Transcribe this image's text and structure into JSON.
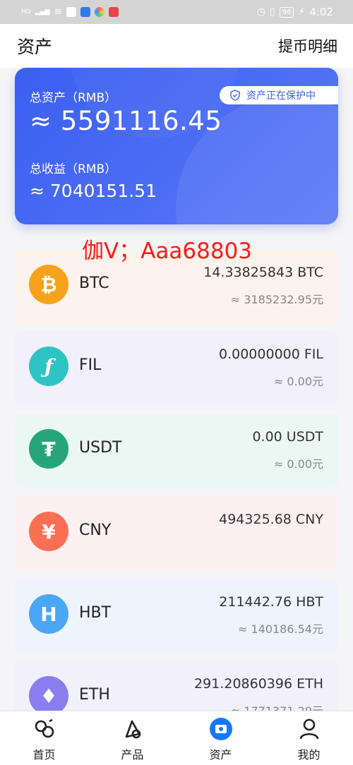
{
  "status_bar": {
    "left_text": "HD",
    "battery": "96",
    "time": "4:02"
  },
  "header": {
    "title": "资产",
    "link": "提币明细"
  },
  "summary": {
    "protect_label": "资产正在保护中",
    "total_label": "总资产（RMB）",
    "total_value": "≈ 5591116.45",
    "income_label": "总收益（RMB）",
    "income_value": "≈ 7040151.51"
  },
  "watermark": "伽V；Aaa68803",
  "coins": [
    {
      "name": "BTC",
      "amount": "14.33825843 BTC",
      "value": "≈ 3185232.95元",
      "icon": "bitcoin-icon",
      "color": "#f7a21b",
      "bg": "#fbf3ec"
    },
    {
      "name": "FIL",
      "amount": "0.00000000 FIL",
      "value": "≈ 0.00元",
      "icon": "filecoin-icon",
      "color": "#2ec4c4",
      "bg": "#f2f0fb"
    },
    {
      "name": "USDT",
      "amount": "0.00 USDT",
      "value": "≈ 0.00元",
      "icon": "tether-icon",
      "color": "#27a57a",
      "bg": "#ebf7f2"
    },
    {
      "name": "CNY",
      "amount": "494325.68 CNY",
      "value": "",
      "icon": "yuan-icon",
      "color": "#fb6f55",
      "bg": "#fdf0f0"
    },
    {
      "name": "HBT",
      "amount": "211442.76 HBT",
      "value": "≈ 140186.54元",
      "icon": "hbt-icon",
      "color": "#4ba6f5",
      "bg": "#edf4fd"
    },
    {
      "name": "ETH",
      "amount": "291.20860396 ETH",
      "value": "≈ 1771371.29元",
      "icon": "ethereum-icon",
      "color": "#8a7df0",
      "bg": "#f2f0fb"
    }
  ],
  "tabs": [
    {
      "label": "首页",
      "icon": "home-icon"
    },
    {
      "label": "产品",
      "icon": "product-icon"
    },
    {
      "label": "资产",
      "icon": "assets-icon",
      "active": true
    },
    {
      "label": "我的",
      "icon": "profile-icon"
    }
  ]
}
